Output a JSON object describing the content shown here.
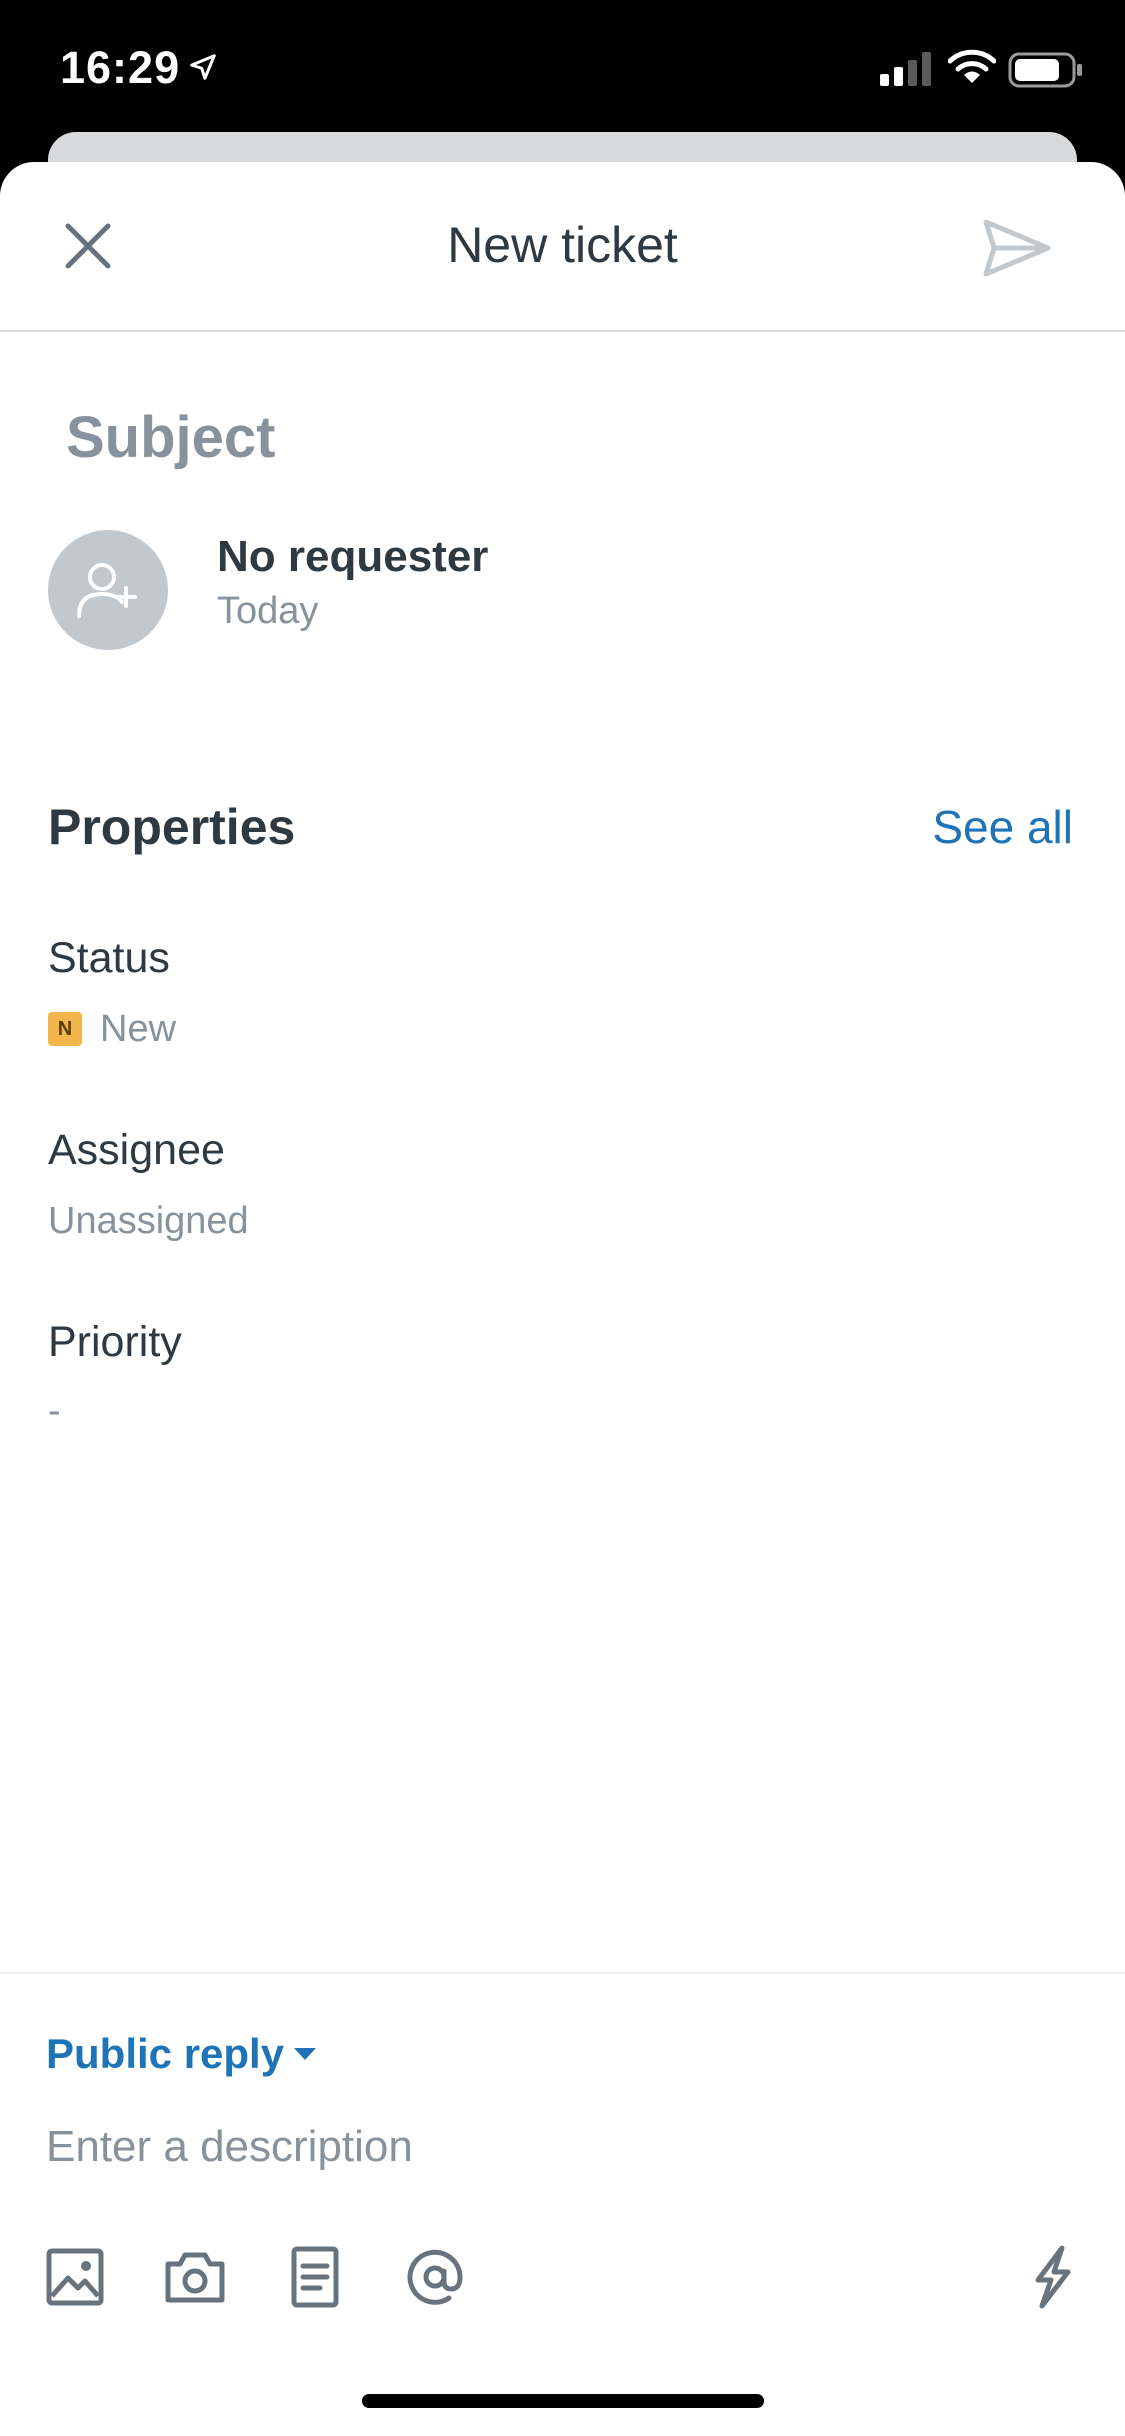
{
  "status_bar": {
    "time": "16:29",
    "icons": [
      "location-arrow-icon",
      "signal-icon",
      "wifi-icon",
      "battery-icon"
    ]
  },
  "nav": {
    "title": "New ticket",
    "close_icon": "close-icon",
    "send_icon": "send-icon"
  },
  "ticket": {
    "subject_placeholder": "Subject",
    "requester": "No requester",
    "date": "Today",
    "avatar_icon": "add-user-icon"
  },
  "properties": {
    "title": "Properties",
    "see_all": "See all",
    "status": {
      "label": "Status",
      "badge": "N",
      "value": "New"
    },
    "assignee": {
      "label": "Assignee",
      "value": "Unassigned"
    },
    "priority": {
      "label": "Priority",
      "value": "-"
    }
  },
  "composer": {
    "reply_type": "Public reply",
    "description_placeholder": "Enter a description",
    "tools": [
      "image-icon",
      "camera-icon",
      "document-icon",
      "at-mention-icon",
      "macro-bolt-icon"
    ]
  },
  "colors": {
    "accent": "#1f73b7",
    "text": "#2f3941",
    "muted": "#87929d",
    "badge_new": "#f3b64c"
  }
}
